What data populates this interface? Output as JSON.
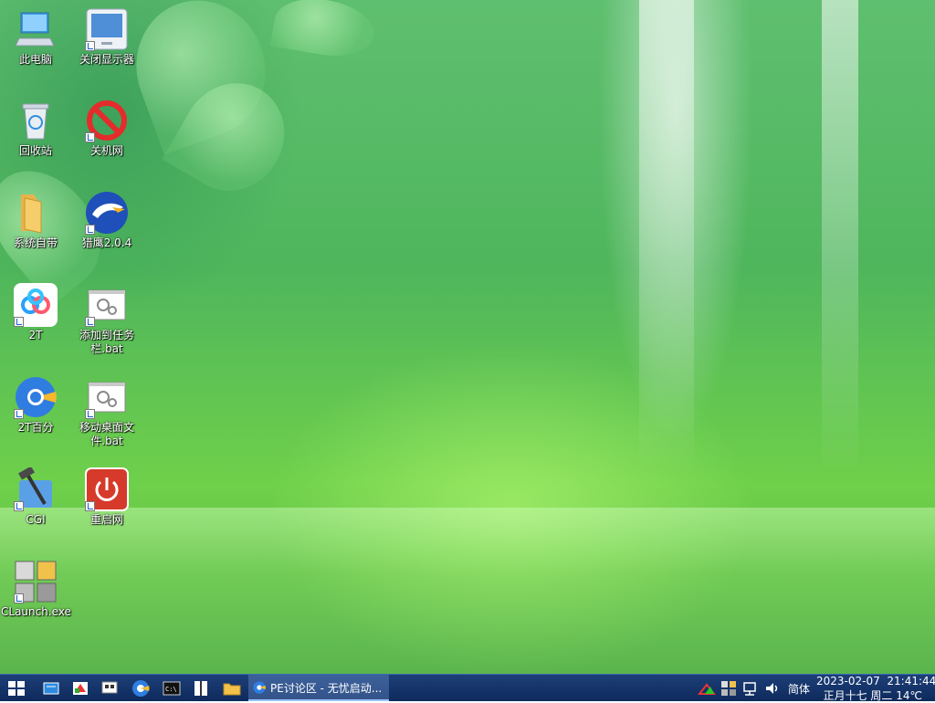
{
  "desktop": {
    "icons": [
      {
        "label": "此电脑"
      },
      {
        "label": "关闭显示器"
      },
      {
        "label": "回收站"
      },
      {
        "label": "关机网"
      },
      {
        "label": "系统自带"
      },
      {
        "label": "猎鹰2.0.4"
      },
      {
        "label": "2T"
      },
      {
        "label": "添加到任务栏.bat"
      },
      {
        "label": "2T百分"
      },
      {
        "label": "移动桌面文件.bat"
      },
      {
        "label": "CGI"
      },
      {
        "label": "重启网"
      },
      {
        "label": "CLaunch.exe"
      }
    ]
  },
  "taskbar": {
    "active_window_title": "PE讨论区 - 无忧启动...",
    "pinned": [
      "start-icon",
      "explorer-app-icon",
      "media-icon",
      "network-tool-icon",
      "browser-icon",
      "cmd-icon",
      "book-icon",
      "folder-icon"
    ],
    "tray": {
      "ime": "简体",
      "date": "2023-02-07",
      "time": "21:41:44",
      "lunar_weather": "正月十七 周二 14℃"
    }
  },
  "colors": {
    "taskbar_bg": "#12326a",
    "desktop_green": "#5fbf70",
    "label_text": "#ffffff"
  }
}
